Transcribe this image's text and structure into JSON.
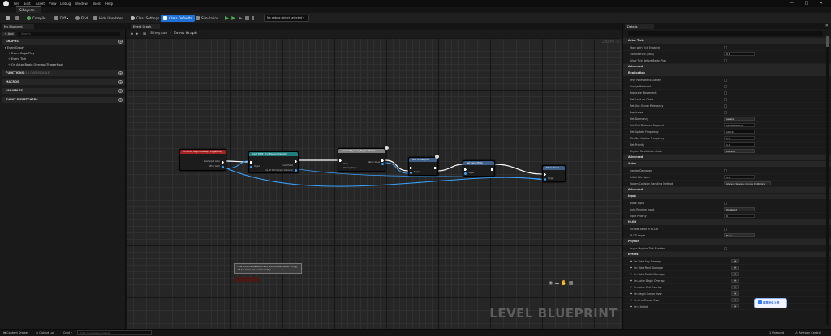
{
  "menu": [
    "File",
    "Edit",
    "Asset",
    "View",
    "Debug",
    "Window",
    "Tools",
    "Help"
  ],
  "document_tab": "Siheyuan",
  "window_controls": [
    "—",
    "□",
    "✕"
  ],
  "toolbar": {
    "save_icon": "save-icon",
    "compile": "Compile",
    "diff": "Diff ▾",
    "find": "Find",
    "hide_unrelated": "Hide Unrelated",
    "class_settings": "Class Settings",
    "class_defaults": "Class Defaults",
    "simulation": "Simulation",
    "debug_object": "No debug object selected ▾",
    "accent": "#1e6fd6"
  },
  "left_panel": {
    "tab": "My Blueprint",
    "add_label": "+ Add",
    "search_placeholder": "Search",
    "graphs_section": "GRAPHS",
    "event_graph": "EventGraph",
    "events": [
      "Event BeginPlay",
      "Event Tick",
      "On Actor Begin Overlap (TriggerBox)"
    ],
    "functions_section": "FUNCTIONS",
    "functions_sub": "(16 OVERRIDABLE)",
    "macros_section": "MACROS",
    "variables_section": "VARIABLES",
    "dispatchers_section": "EVENT DISPATCHERS"
  },
  "graph": {
    "tab": "Event Graph",
    "breadcrumb_root": "Siheyuan",
    "breadcrumb_graph": "Event Graph",
    "zoom": "Zoom -5",
    "watermark": "LEVEL BLUEPRINT",
    "disabled_note": "This node is disabled and will not be called. Drag off pin to build functionality.",
    "nodes": [
      {
        "title": "On Actor Begin Overlap (TriggerBox)",
        "pins": [
          "Overlapped Actor",
          "Other Actor"
        ],
        "head": "#a32323"
      },
      {
        "title": "Cast To BP_ThirdPersonCharacter",
        "pins": [
          "Object",
          "Cast Failed",
          "As BP Third Person Character"
        ],
        "head": "#1e7d7d"
      },
      {
        "title": "Create BP_Level_Trigger Widget",
        "pins": [
          "Class",
          "Owning Player",
          "Return Value"
        ],
        "head": "#7f7f7f"
      },
      {
        "title": "Add to Viewport",
        "pins": [
          "Target"
        ],
        "head": "#3e5f87"
      },
      {
        "title": "Set Input Mode",
        "pins": [
          "Target"
        ],
        "head": "#3e5f87"
      },
      {
        "title": "Show Mouse",
        "pins": [
          "Target"
        ],
        "head": "#3e5f87"
      }
    ]
  },
  "details": {
    "tab": "Details",
    "categories": [
      {
        "name": "Actor Tick",
        "rows": [
          {
            "label": "Start with Tick Enabled",
            "type": "check",
            "value": true
          },
          {
            "label": "Tick Interval (secs)",
            "type": "input",
            "value": "0.0"
          },
          {
            "label": "Allow Tick Before Begin Play",
            "type": "check",
            "value": false
          }
        ]
      },
      {
        "name": "Advanced",
        "rows": []
      },
      {
        "name": "Replication",
        "rows": [
          {
            "label": "Only Relevant to Owner",
            "type": "check",
            "value": false
          },
          {
            "label": "Always Relevant",
            "type": "check",
            "value": false
          },
          {
            "label": "Replicate Movement",
            "type": "check",
            "value": false
          },
          {
            "label": "Net Load on Client",
            "type": "check",
            "value": true
          },
          {
            "label": "Net Use Owner Relevancy",
            "type": "check",
            "value": false
          },
          {
            "label": "Replicates",
            "type": "check",
            "value": false
          },
          {
            "label": "Net Dormancy",
            "type": "select",
            "value": "Awake"
          },
          {
            "label": "Net Cull Distance Squared",
            "type": "input",
            "value": "225000000.0"
          },
          {
            "label": "Net Update Frequency",
            "type": "input",
            "value": "100.0"
          },
          {
            "label": "Min Net Update Frequency",
            "type": "input",
            "value": "2.0"
          },
          {
            "label": "Net Priority",
            "type": "input",
            "value": "1.0"
          },
          {
            "label": "Physics Replication Mode",
            "type": "select",
            "value": "Default"
          }
        ]
      },
      {
        "name": "Advanced",
        "rows": []
      },
      {
        "name": "Actor",
        "rows": [
          {
            "label": "Can be Damaged",
            "type": "check",
            "value": false
          },
          {
            "label": "Initial Life Span",
            "type": "input",
            "value": "0.0"
          },
          {
            "label": "Spawn Collision Handling Method",
            "type": "select",
            "value": "Always Spawn, Ignore Collisions"
          }
        ]
      },
      {
        "name": "Advanced",
        "rows": []
      },
      {
        "name": "Input",
        "rows": [
          {
            "label": "Block Input",
            "type": "check",
            "value": false
          },
          {
            "label": "Auto Receive Input",
            "type": "select",
            "value": "Disabled"
          },
          {
            "label": "Input Priority",
            "type": "input",
            "value": "0"
          }
        ]
      },
      {
        "name": "HLOD",
        "rows": [
          {
            "label": "Include Actor in HLOD",
            "type": "check",
            "value": true
          },
          {
            "label": "HLOD Layer",
            "type": "select",
            "value": "None"
          }
        ]
      },
      {
        "name": "Physics",
        "rows": [
          {
            "label": "Async Physics Tick Enabled",
            "type": "check",
            "value": false
          }
        ]
      },
      {
        "name": "Events",
        "rows": [
          {
            "label": "On Take Any Damage",
            "type": "event"
          },
          {
            "label": "On Take Point Damage",
            "type": "event"
          },
          {
            "label": "On Take Radial Damage",
            "type": "event"
          },
          {
            "label": "On Actor Begin Overlap",
            "type": "event"
          },
          {
            "label": "On Actor End Overlap",
            "type": "event"
          },
          {
            "label": "On Begin Cursor Over",
            "type": "event"
          },
          {
            "label": "On End Cursor Over",
            "type": "event"
          },
          {
            "label": "On Clicked",
            "type": "event"
          }
        ]
      }
    ],
    "badge": "推荐优化上传"
  },
  "status": {
    "content_drawer": "Content Drawer",
    "output_log": "Output Log",
    "cmd": "Cmd ▾",
    "cmd_placeholder": "Enter Console Command",
    "unsaved": "1 Unsaved",
    "revision_control": "Revision Control"
  }
}
